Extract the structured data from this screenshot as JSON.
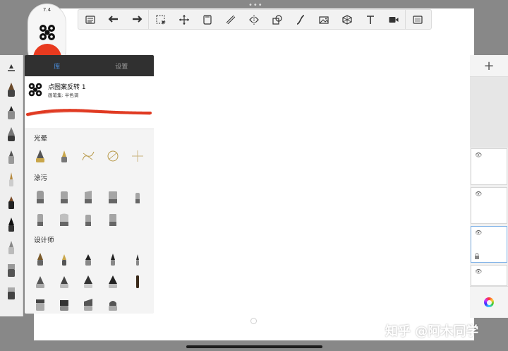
{
  "brush_size": "7.4",
  "tabs": [
    {
      "label": "库",
      "active": true
    },
    {
      "label": "设置",
      "active": false
    }
  ],
  "current_brush": {
    "name": "点图案反转 1",
    "sub": "画笔集: 半色调"
  },
  "sections": [
    {
      "label": "光晕"
    },
    {
      "label": "涂污"
    },
    {
      "label": "设计师"
    }
  ],
  "right_panel": {
    "add_label": "+"
  },
  "watermark": "知乎 @阿木同学",
  "colors": {
    "accent": "#4a90e2",
    "current_color": "#e83a1f",
    "panel_dark": "#303030"
  }
}
